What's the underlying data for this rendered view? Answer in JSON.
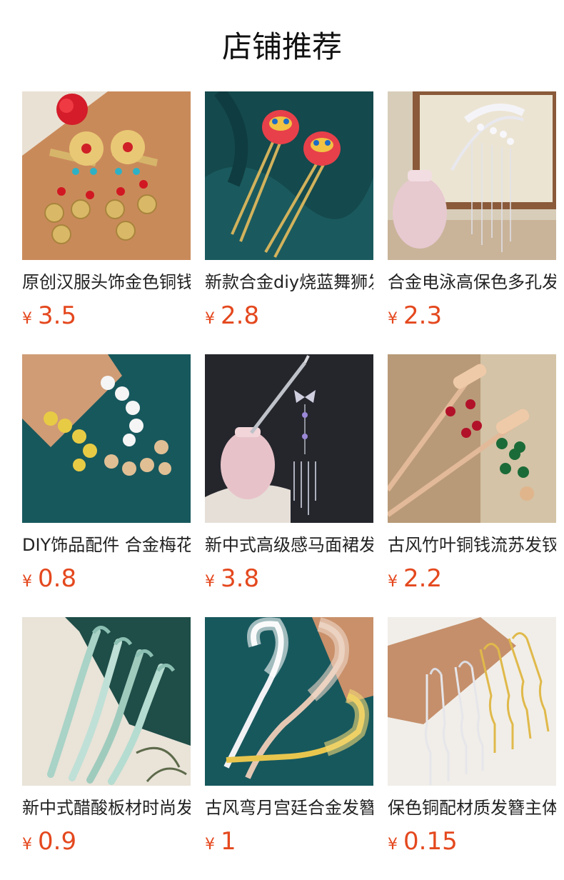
{
  "header": {
    "title": "店铺推荐"
  },
  "currency": "¥",
  "products": [
    {
      "name": "原创汉服头饰金色铜钱流苏发夹",
      "price": "3.5",
      "image": "gold-flower-coin-hairclips"
    },
    {
      "name": "新款合金diy烧蓝舞狮发簪",
      "price": "2.8",
      "image": "enamel-lion-hairpins"
    },
    {
      "name": "合金电泳高保色多孔发钗",
      "price": "2.3",
      "image": "silver-pearl-tassel-hairpin"
    },
    {
      "name": "DIY饰品配件 合金梅花枝",
      "price": "0.8",
      "image": "alloy-plum-blossom-branches"
    },
    {
      "name": "新中式高级感马面裙发簪",
      "price": "3.8",
      "image": "butterfly-tassel-hairstick"
    },
    {
      "name": "古风竹叶铜钱流苏发钗",
      "price": "2.2",
      "image": "bamboo-coin-tassel-hairpins"
    },
    {
      "name": "新中式醋酸板材时尚发簪",
      "price": "0.9",
      "image": "acetate-wave-hairsticks"
    },
    {
      "name": "古风弯月宫廷合金发簪",
      "price": "1",
      "image": "crescent-filigree-hairpins"
    },
    {
      "name": "保色铜配材质发簪主体",
      "price": "0.15",
      "image": "u-shaped-hairpin-bases"
    }
  ]
}
